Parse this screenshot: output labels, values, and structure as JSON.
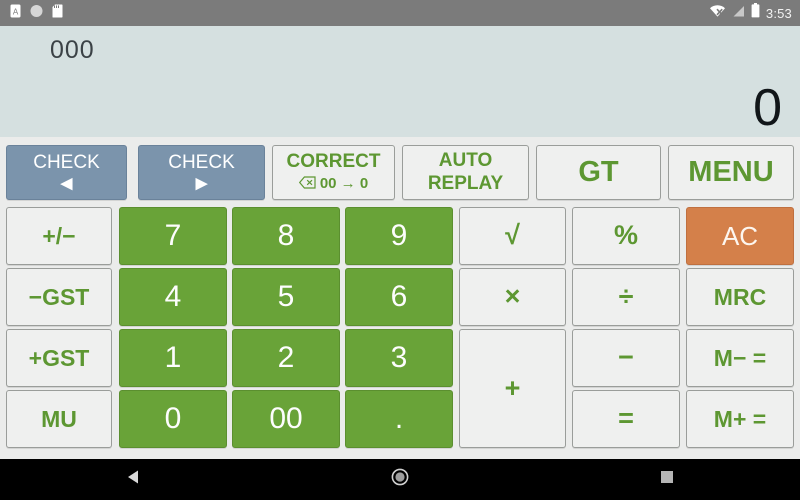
{
  "statusbar": {
    "time": "3:53",
    "left_icons": [
      "sim-card-a-icon",
      "circle-icon",
      "sd-card-icon"
    ],
    "right_icons": [
      "wifi-off-icon",
      "signal-icon",
      "battery-icon"
    ]
  },
  "display": {
    "memory_indicator": "000",
    "value": "0"
  },
  "colors": {
    "display_bg": "#d5e0e0",
    "keypad_bg": "#ebeceb",
    "key_bg": "#eff0ef",
    "key_text": "#5d9732",
    "number_key_bg": "#69a338",
    "check_key_bg": "#7b94ac",
    "ac_key_bg": "#d4804a",
    "statusbar_bg": "#7b7b7b",
    "navbar_bg": "#000000"
  },
  "keypad": {
    "function_row": [
      {
        "name": "check-back-button",
        "label": "CHECK",
        "sub": "◀",
        "style": "check"
      },
      {
        "name": "check-forward-button",
        "label": "CHECK",
        "sub": "▶",
        "style": "check"
      },
      {
        "name": "correct-button",
        "label": "CORRECT",
        "sub_icon": "backspace-icon",
        "sub": "00 → 0",
        "style": "plain"
      },
      {
        "name": "auto-replay-button",
        "label": "AUTO",
        "sub": "REPLAY",
        "style": "plain"
      },
      {
        "name": "grand-total-button",
        "label": "GT",
        "style": "plain"
      },
      {
        "name": "menu-button",
        "label": "MENU",
        "style": "plain"
      }
    ],
    "left_column": [
      {
        "name": "sign-toggle-button",
        "label": "+/−"
      },
      {
        "name": "minus-gst-button",
        "label": "−GST"
      },
      {
        "name": "plus-gst-button",
        "label": "+GST"
      },
      {
        "name": "markup-button",
        "label": "MU"
      }
    ],
    "numbers": [
      {
        "name": "digit-7-button",
        "label": "7"
      },
      {
        "name": "digit-8-button",
        "label": "8"
      },
      {
        "name": "digit-9-button",
        "label": "9"
      },
      {
        "name": "digit-4-button",
        "label": "4"
      },
      {
        "name": "digit-5-button",
        "label": "5"
      },
      {
        "name": "digit-6-button",
        "label": "6"
      },
      {
        "name": "digit-1-button",
        "label": "1"
      },
      {
        "name": "digit-2-button",
        "label": "2"
      },
      {
        "name": "digit-3-button",
        "label": "3"
      },
      {
        "name": "digit-0-button",
        "label": "0"
      },
      {
        "name": "digit-00-button",
        "label": "00"
      },
      {
        "name": "decimal-point-button",
        "label": "."
      }
    ],
    "operators": [
      {
        "name": "square-root-button",
        "label": "√"
      },
      {
        "name": "percent-button",
        "label": "%"
      },
      {
        "name": "multiply-button",
        "label": "×"
      },
      {
        "name": "divide-button",
        "label": "÷"
      },
      {
        "name": "add-button",
        "label": "+"
      },
      {
        "name": "subtract-button",
        "label": "−"
      },
      {
        "name": "equals-button",
        "label": "="
      }
    ],
    "right_column": [
      {
        "name": "all-clear-button",
        "label": "AC"
      },
      {
        "name": "memory-recall-button",
        "label": "MRC"
      },
      {
        "name": "memory-minus-button",
        "label": "M− ="
      },
      {
        "name": "memory-plus-button",
        "label": "M+ ="
      }
    ]
  },
  "navbar": {
    "items": [
      {
        "name": "nav-back-button",
        "icon": "back-triangle-icon"
      },
      {
        "name": "nav-home-button",
        "icon": "home-circle-icon"
      },
      {
        "name": "nav-recents-button",
        "icon": "recents-square-icon"
      }
    ]
  }
}
